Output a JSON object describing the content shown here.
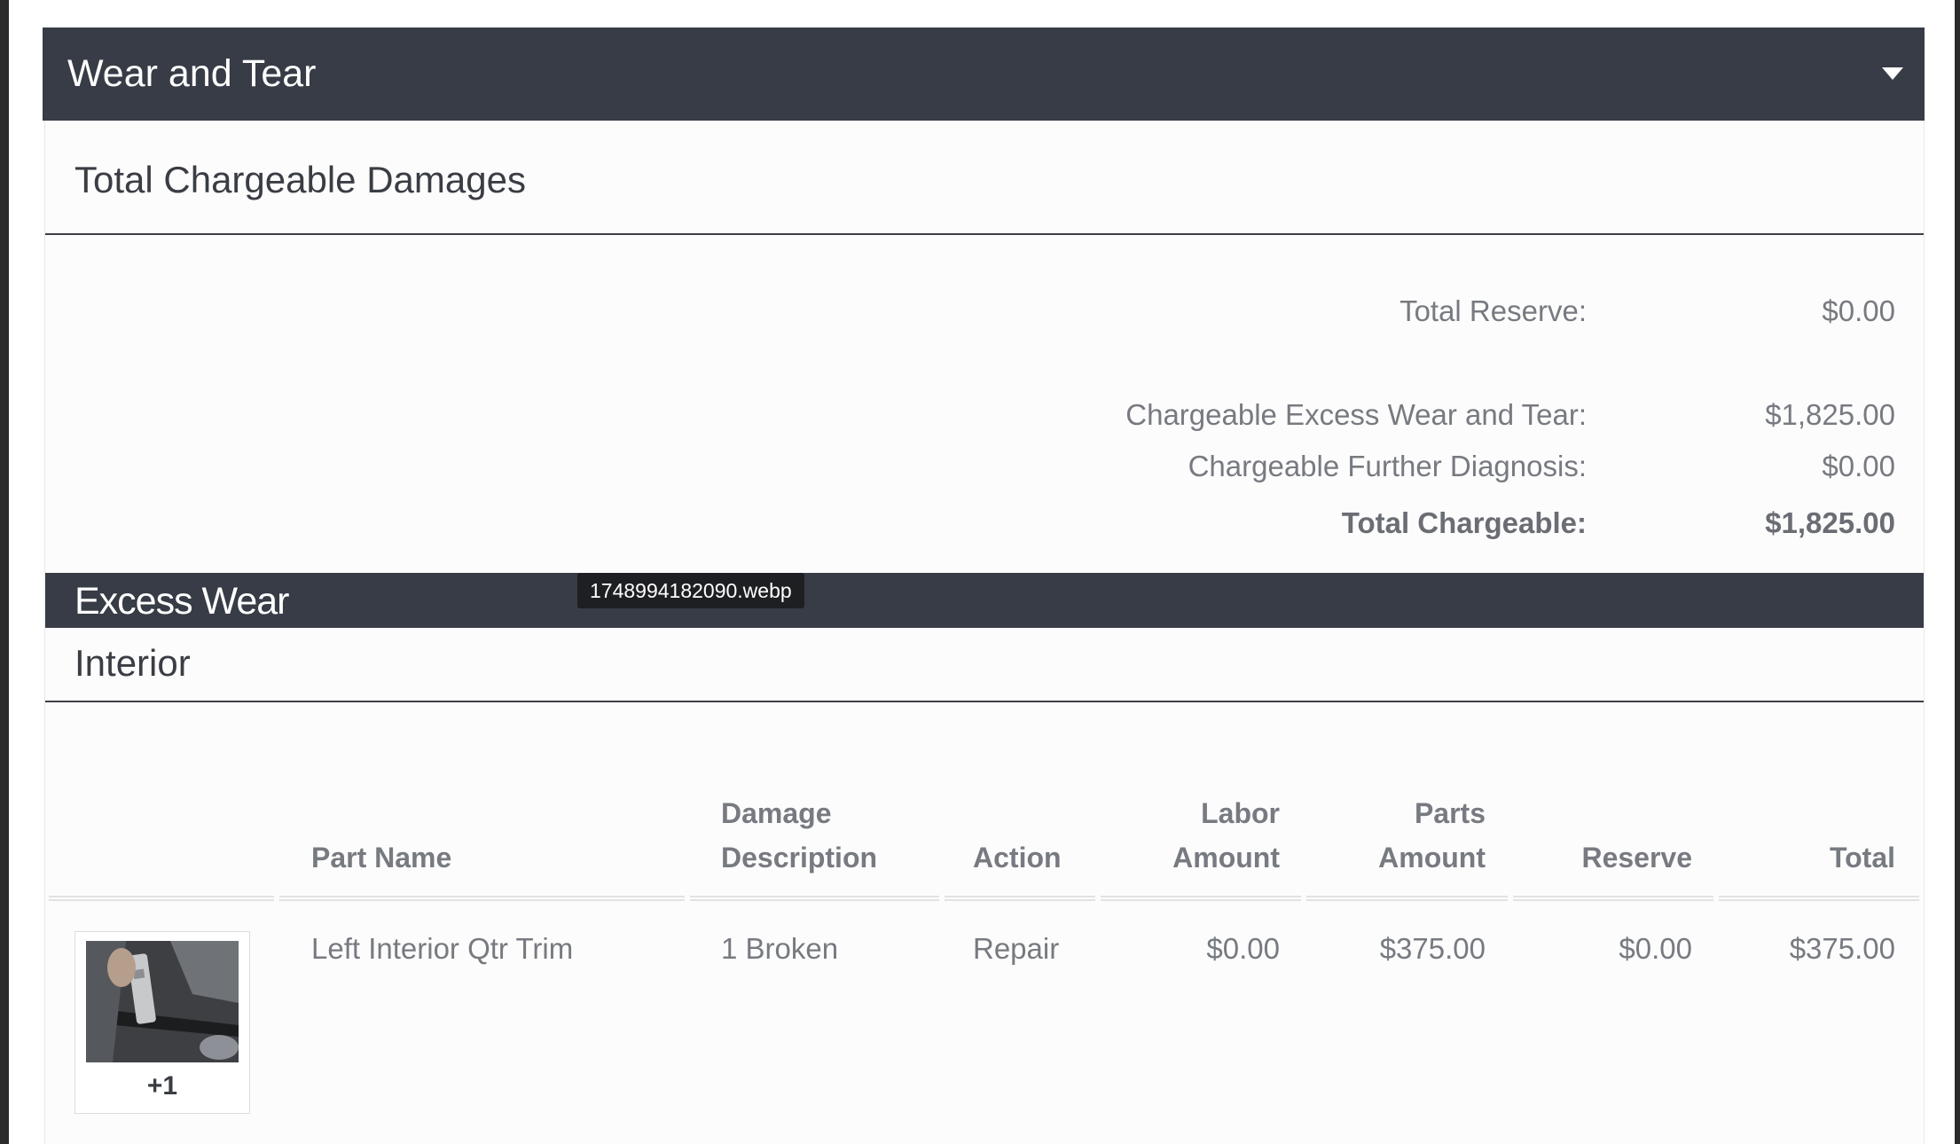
{
  "header": {
    "title": "Wear and Tear"
  },
  "summary": {
    "title": "Total Chargeable Damages",
    "rows": [
      {
        "label": "Total Reserve:",
        "value": "$0.00"
      },
      {
        "label": "Chargeable Excess Wear and Tear:",
        "value": "$1,825.00"
      },
      {
        "label": "Chargeable Further Diagnosis:",
        "value": "$0.00"
      },
      {
        "label": "Total Chargeable:",
        "value": "$1,825.00"
      }
    ]
  },
  "excess": {
    "title": "Excess Wear",
    "tooltip": "1748994182090.webp"
  },
  "interior": {
    "title": "Interior",
    "columns": {
      "part_name": "Part Name",
      "damage_1": "Damage",
      "damage_2": "Description",
      "action": "Action",
      "labor_1": "Labor",
      "labor_2": "Amount",
      "parts_1": "Parts",
      "parts_2": "Amount",
      "reserve": "Reserve",
      "total": "Total"
    },
    "rows": [
      {
        "photo_count": "+1",
        "part_name": "Left Interior Qtr Trim",
        "damage": "1 Broken",
        "action": "Repair",
        "labor": "$0.00",
        "parts": "$375.00",
        "reserve": "$0.00",
        "total": "$375.00"
      }
    ]
  },
  "colors": {
    "header_bg": "#373c46",
    "text_muted": "#777a80"
  }
}
